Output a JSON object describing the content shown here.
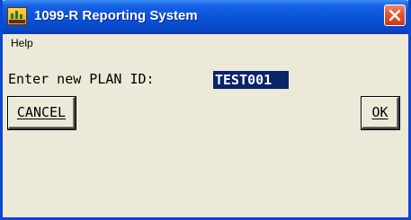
{
  "window": {
    "title": "1099-R Reporting System",
    "icon": "app-chart-icon",
    "close_icon": "close-icon"
  },
  "menu": {
    "items": [
      {
        "label": "Help"
      }
    ]
  },
  "form": {
    "prompt_label": "Enter new PLAN ID:",
    "plan_id_value": "TEST001"
  },
  "buttons": {
    "cancel_label": "CANCEL",
    "ok_label": "OK"
  },
  "colors": {
    "titlebar_blue": "#0a53d9",
    "close_red": "#e2542f",
    "selection_navy": "#0a246a",
    "dialog_bg": "#ece9d8"
  }
}
